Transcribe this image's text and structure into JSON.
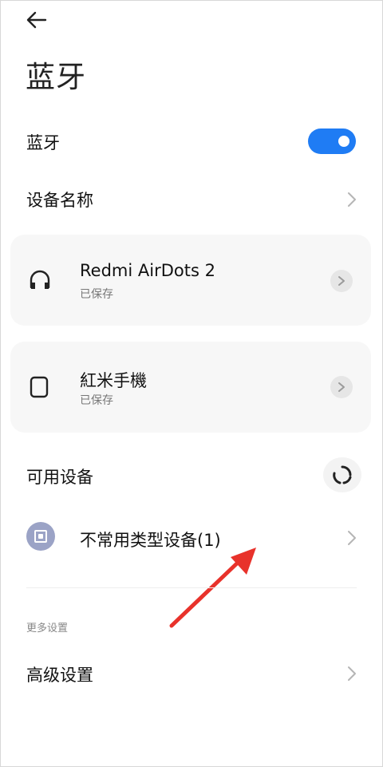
{
  "header": {
    "title": "蓝牙"
  },
  "bluetooth": {
    "label": "蓝牙",
    "enabled": true
  },
  "device_name": {
    "label": "设备名称"
  },
  "saved_devices": [
    {
      "name": "Redmi AirDots 2",
      "status": "已保存",
      "icon": "headphones-icon"
    },
    {
      "name": "紅米手機",
      "status": "已保存",
      "icon": "phone-icon"
    }
  ],
  "available": {
    "label": "可用设备",
    "items": [
      {
        "name": "不常用类型设备(1)",
        "icon": "device-icon"
      }
    ]
  },
  "more_settings": {
    "section_label": "更多设置",
    "advanced_label": "高级设置"
  },
  "annotation": {
    "color": "#e8322b",
    "icon": "red-arrow"
  },
  "colors": {
    "accent": "#1f7cf4",
    "card_bg": "#f7f7f7"
  }
}
